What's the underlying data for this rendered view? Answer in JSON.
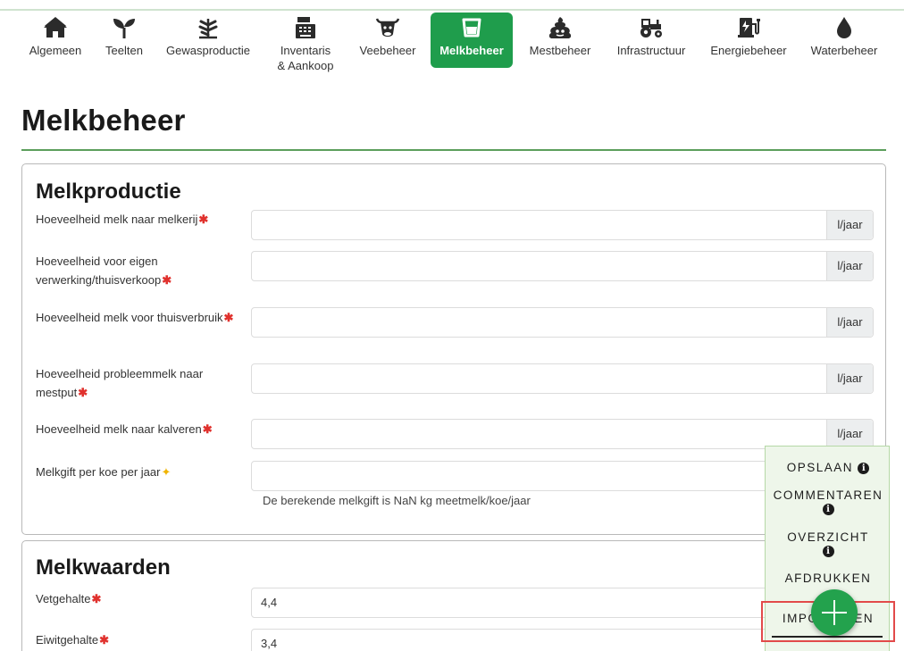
{
  "nav": {
    "items": [
      {
        "label": "Algemeen",
        "icon": "home-icon"
      },
      {
        "label": "Teelten",
        "icon": "sprout-icon"
      },
      {
        "label": "Gewasproductie",
        "icon": "plant-icon"
      },
      {
        "label": "Inventaris & Aankoop",
        "icon": "cash-register-icon"
      },
      {
        "label": "Veebeheer",
        "icon": "cow-icon"
      },
      {
        "label": "Melkbeheer",
        "icon": "milk-bucket-icon",
        "active": true
      },
      {
        "label": "Mestbeheer",
        "icon": "manure-icon"
      },
      {
        "label": "Infrastructuur",
        "icon": "tractor-icon"
      },
      {
        "label": "Energiebeheer",
        "icon": "ev-charger-icon"
      },
      {
        "label": "Waterbeheer",
        "icon": "water-drop-icon"
      }
    ],
    "inventaris_line1": "Inventaris",
    "inventaris_line2": "& Aankoop"
  },
  "page": {
    "title": "Melkbeheer"
  },
  "melkproductie": {
    "title": "Melkproductie",
    "fields": [
      {
        "label": "Hoeveelheid melk naar melkerij",
        "unit": "l/jaar",
        "value": "",
        "required": true
      },
      {
        "label": "Hoeveelheid voor eigen verwerking/thuisverkoop",
        "unit": "l/jaar",
        "value": "",
        "required": true
      },
      {
        "label": "Hoeveelheid melk voor thuisverbruik",
        "unit": "l/jaar",
        "value": "",
        "required": true
      },
      {
        "label": "Hoeveelheid probleemmelk naar mestput",
        "unit": "l/jaar",
        "value": "",
        "required": true
      },
      {
        "label": "Hoeveelheid melk naar kalveren",
        "unit": "l/jaar",
        "value": "",
        "required": true
      },
      {
        "label": "Melkgift per koe per jaar",
        "unit": "",
        "value": "",
        "required": false
      }
    ],
    "hint": "De berekende melkgift is NaN kg meetmelk/koe/jaar"
  },
  "melkwaarden": {
    "title": "Melkwaarden",
    "fields": [
      {
        "label": "Vetgehalte",
        "value": "4,4",
        "required": true
      },
      {
        "label": "Eiwitgehalte",
        "value": "3,4",
        "required": true
      }
    ]
  },
  "fab": {
    "opslaan": "OPSLAAN",
    "commentaren": "COMMENTAREN",
    "overzicht": "OVERZICHT",
    "afdrukken": "AFDRUKKEN",
    "importeren_left": "IMPO",
    "importeren_right": "EN"
  },
  "colors": {
    "accent": "#1f9d4c",
    "required": "#e0312d",
    "optional": "#f0b400",
    "rule": "#5b9e5b",
    "highlight": "#e24a4a"
  }
}
